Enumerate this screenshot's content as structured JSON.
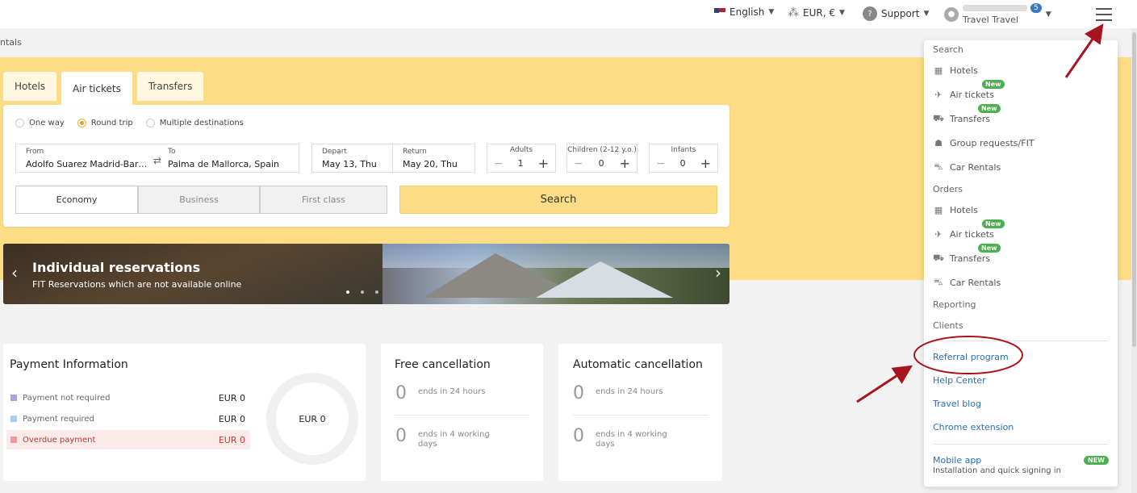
{
  "topbar": {
    "language": "English",
    "currency": "EUR, €",
    "support": "Support",
    "user_name": "Travel Travel",
    "notifications": "5"
  },
  "breadcrumb": "ntals",
  "tabs": [
    "Hotels",
    "Air tickets",
    "Transfers"
  ],
  "trip_types": [
    "One way",
    "Round trip",
    "Multiple destinations"
  ],
  "form": {
    "from_label": "From",
    "from_value": "Adolfo Suarez Madrid-Bar…",
    "to_label": "To",
    "to_value": "Palma de Mallorca, Spain",
    "depart_label": "Depart",
    "depart_value": "May 13, Thu",
    "return_label": "Return",
    "return_value": "May 20, Thu",
    "adults_label": "Adults",
    "adults_value": "1",
    "children_label": "Children (2-12 y.o.)",
    "children_value": "0",
    "infants_label": "Infants",
    "infants_value": "0",
    "classes": [
      "Economy",
      "Business",
      "First class"
    ],
    "search_button": "Search"
  },
  "banner": {
    "title": "Individual reservations",
    "subtitle": "FIT Reservations which are not available online"
  },
  "payment": {
    "title": "Payment Information",
    "rows": [
      {
        "label": "Payment not required",
        "amount": "EUR 0",
        "color": "#b39ddb"
      },
      {
        "label": "Payment required",
        "amount": "EUR 0",
        "color": "#a8cff0"
      },
      {
        "label": "Overdue payment",
        "amount": "EUR 0",
        "color": "#ef9a9a"
      }
    ],
    "donut_label": "EUR 0"
  },
  "free_cancel": {
    "title": "Free cancellation",
    "rows": [
      {
        "count": "0",
        "text": "ends in 24 hours"
      },
      {
        "count": "0",
        "text": "ends in 4 working days"
      }
    ]
  },
  "auto_cancel": {
    "title": "Automatic cancellation",
    "rows": [
      {
        "count": "0",
        "text": "ends in 24 hours"
      },
      {
        "count": "0",
        "text": "ends in 4 working days"
      }
    ]
  },
  "menu": {
    "search_head": "Search",
    "search_items": [
      "Hotels",
      "Air tickets",
      "Transfers",
      "Group requests/FIT",
      "Car Rentals"
    ],
    "orders_head": "Orders",
    "orders_items": [
      "Hotels",
      "Air tickets",
      "Transfers",
      "Car Rentals"
    ],
    "new_badge": "New",
    "reporting": "Reporting",
    "clients": "Clients",
    "links": [
      "Referral program",
      "Help Center",
      "Travel blog",
      "Chrome extension"
    ],
    "mobile_app": "Mobile app",
    "mobile_sub": "Installation and quick signing in",
    "mobile_badge": "NEW"
  },
  "colors": {
    "accent_yellow": "#fcdc84",
    "link_blue": "#2a6eb8",
    "badge_green": "#4caf50",
    "annotation_red": "#a8141e"
  }
}
